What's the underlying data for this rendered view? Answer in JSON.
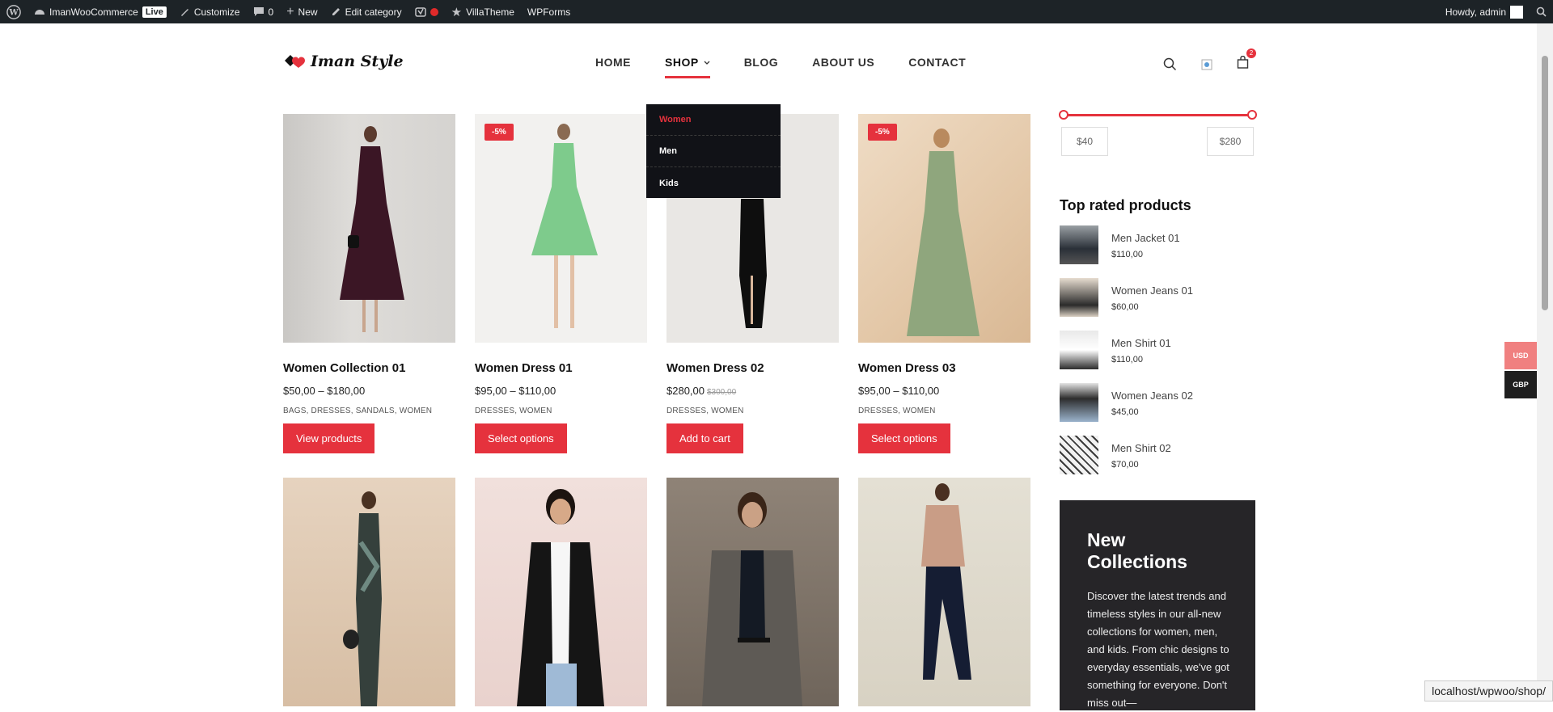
{
  "admin_bar": {
    "site_name": "ImanWooCommerce",
    "live_badge": "Live",
    "customize": "Customize",
    "comments_count": "0",
    "new_label": "New",
    "edit_category": "Edit category",
    "villatheme": "VillaTheme",
    "wpforms": "WPForms",
    "howdy": "Howdy, admin"
  },
  "header": {
    "logo_text": "Iman Style",
    "nav": [
      {
        "label": "HOME"
      },
      {
        "label": "SHOP"
      },
      {
        "label": "BLOG"
      },
      {
        "label": "ABOUT US"
      },
      {
        "label": "CONTACT"
      }
    ],
    "cart_count": "2"
  },
  "shop_dropdown": {
    "items": [
      {
        "label": "Women"
      },
      {
        "label": "Men"
      },
      {
        "label": "Kids"
      }
    ]
  },
  "products": [
    {
      "name": "Women Collection 01",
      "price": "$50,00 – $180,00",
      "old_price": "",
      "categories": "BAGS, DRESSES, SANDALS, WOMEN",
      "button": "View products",
      "sale": ""
    },
    {
      "name": "Women Dress 01",
      "price": "$95,00 – $110,00",
      "old_price": "",
      "categories": "DRESSES, WOMEN",
      "button": "Select options",
      "sale": "-5%"
    },
    {
      "name": "Women Dress 02",
      "price": "$280,00",
      "old_price": "$300,00",
      "categories": "DRESSES, WOMEN",
      "button": "Add to cart",
      "sale": ""
    },
    {
      "name": "Women Dress 03",
      "price": "$95,00 – $110,00",
      "old_price": "",
      "categories": "DRESSES, WOMEN",
      "button": "Select options",
      "sale": "-5%"
    }
  ],
  "sidebar": {
    "price_min": "$40",
    "price_max": "$280",
    "top_rated_title": "Top rated products",
    "top_rated": [
      {
        "name": "Men Jacket 01",
        "price": "$110,00"
      },
      {
        "name": "Women Jeans 01",
        "price": "$60,00"
      },
      {
        "name": "Men Shirt 01",
        "price": "$110,00"
      },
      {
        "name": "Women Jeans 02",
        "price": "$45,00"
      },
      {
        "name": "Men Shirt 02",
        "price": "$70,00"
      }
    ],
    "promo_title": "New Collections",
    "promo_text": "Discover the latest trends and timeless styles in our all-new collections for women, men, and kids. From chic designs to everyday essentials, we've got something for everyone. Don't miss out—"
  },
  "currency": {
    "usd": "USD",
    "gbp": "GBP"
  },
  "status_url": "localhost/wpwoo/shop/",
  "colors": {
    "accent": "#e5323d",
    "admin_bar": "#1d2327",
    "dropdown": "#111217",
    "promo": "#262528"
  }
}
